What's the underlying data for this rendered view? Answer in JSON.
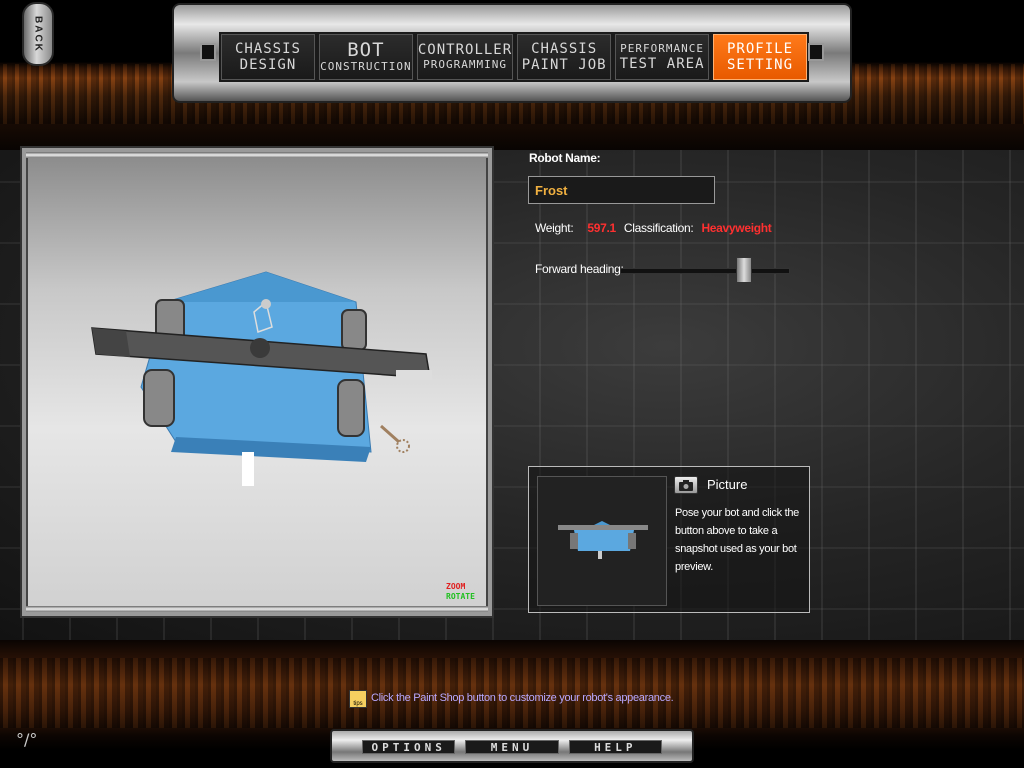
{
  "back": {
    "label": "BACK"
  },
  "nav": {
    "tabs": [
      {
        "line1": "CHASSIS",
        "line2": "DESIGN"
      },
      {
        "line1": "BOT",
        "line2": "CONSTRUCTION"
      },
      {
        "line1": "CONTROLLER",
        "line2": "PROGRAMMING"
      },
      {
        "line1": "CHASSIS",
        "line2": "PAINT JOB"
      },
      {
        "line1": "PERFORMANCE",
        "line2": "TEST AREA"
      },
      {
        "line1": "PROFILE",
        "line2": "SETTING"
      }
    ],
    "active_tab": "PROFILE SETTING"
  },
  "viewport": {
    "zoom_label": "ZOOM",
    "rotate_label": "ROTATE"
  },
  "profile": {
    "name_label": "Robot Name:",
    "name_value": "Frost",
    "weight_label": "Weight:",
    "weight_value": "597.1",
    "class_label": "Classification:",
    "class_value": "Heavyweight",
    "heading_label": "Forward heading:",
    "heading_position": 0.75
  },
  "picture": {
    "title": "Picture",
    "description": "Pose your bot and click the button above to take a snapshot used as your bot preview."
  },
  "tip": {
    "icon_text": "tips",
    "text": "Click the Paint Shop button to customize your robot's appearance."
  },
  "bottom": {
    "options": "OPTIONS",
    "menu": "MENU",
    "help": "HELP"
  },
  "colors": {
    "accent": "#ff7a1a",
    "robot_body": "#5ba8e0",
    "value_red": "#ff3030",
    "name_gold": "#f0b040"
  }
}
